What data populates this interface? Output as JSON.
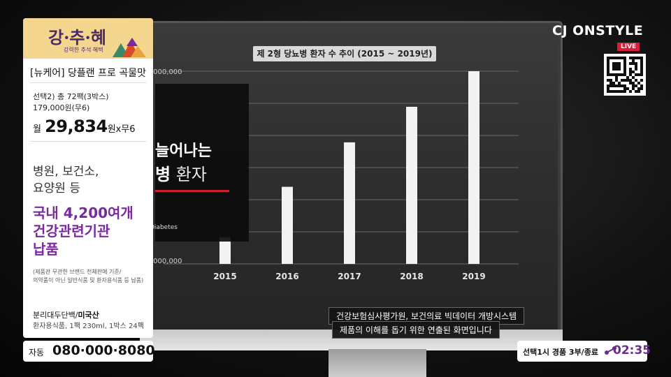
{
  "brand": {
    "name": "CJ ONSTYLE",
    "live_label": "LIVE"
  },
  "promo_logo": {
    "title": "강·추·혜",
    "subtitle": "강력한 추석 혜택"
  },
  "product": {
    "name": "[뉴케어] 당플랜 프로 곡물맛",
    "option_line1": "선택2) 총 72팩(3박스)",
    "option_line2": "179,000원(무6)",
    "price_prefix": "월",
    "price_value": "29,834",
    "price_suffix": "원x무6",
    "headline": [
      "병원, 보건소,",
      "요양원 등"
    ],
    "highlight": [
      "국내 4,200여개",
      "건강관련기관",
      "납품"
    ],
    "note": [
      "(제품관 무관한 브랜드 전체판매 기준/",
      "의약품이 아닌 일반식품 및 환자용식품 등 납품)"
    ],
    "origin_label": "분리대두단백/",
    "origin_value": "미국산",
    "spec": "환자용식품, 1팩 230ml, 1박스 24팩"
  },
  "phone": {
    "label": "자동",
    "number": "080·000·8080"
  },
  "status": {
    "text": "선택1시 경품 3부/종료",
    "time": "02:35"
  },
  "screen": {
    "chart_title": "제 2형 당뇨병 환자 수 추이 (2015 ~ 2019년)",
    "overlay_line1": "늘어나는",
    "overlay_line2_bold": "병",
    "overlay_line2_thin": " 환자",
    "overlay_tag": "Diabetes",
    "y_tick_top": ",000,000",
    "y_tick_bottom": ",000,000",
    "notice_line1": "건강보험심사평가원, 보건의료 빅데이터 개방시스템",
    "notice_line2": "제품의 이해를 돕기 위한 연출된 화면입니다"
  },
  "chart_data": {
    "type": "bar",
    "title": "제 2형 당뇨병 환자 수 추이 (2015 ~ 2019년)",
    "categories": [
      "2015",
      "2016",
      "2017",
      "2018",
      "2019"
    ],
    "values": [
      0.9,
      2.6,
      4.1,
      5.3,
      6.5
    ],
    "ylim": [
      0,
      6.5
    ],
    "xlabel": "",
    "ylabel": "",
    "grid": true,
    "bar_color": "#f2f2f2"
  },
  "colors": {
    "accent_purple": "#7a2a9e",
    "live_red": "#d81f3a",
    "panel_yellow": "#f4d68f"
  }
}
